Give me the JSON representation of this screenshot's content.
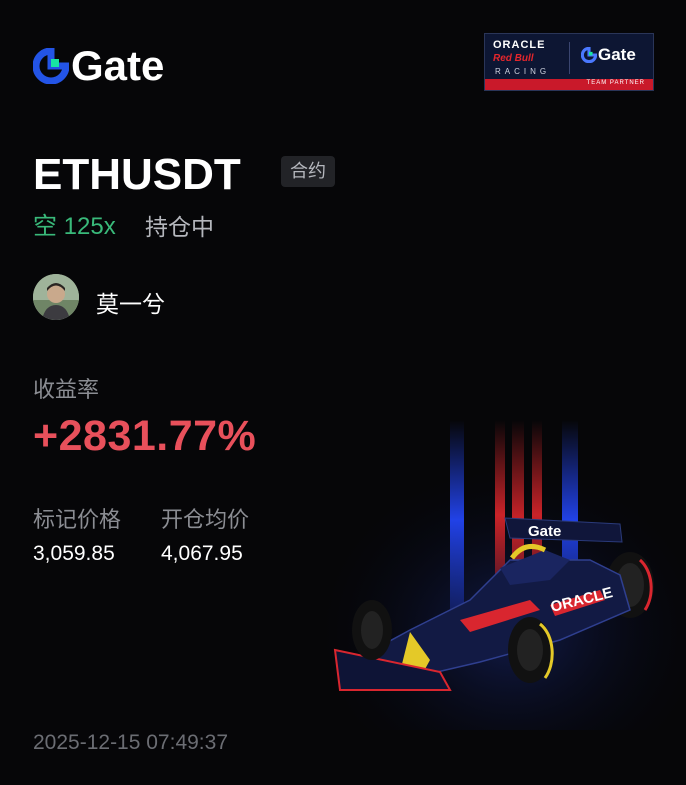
{
  "brand": {
    "name": "Gate",
    "icon": "gate-logo-icon"
  },
  "partner": {
    "line1": "ORACLE",
    "line2": "Red Bull",
    "line3": "RACING",
    "brand": "Gate",
    "caption": "TEAM PARTNER"
  },
  "position": {
    "symbol": "ETHUSDT",
    "type_tag": "合约",
    "direction": "空 125x",
    "status": "持仓中"
  },
  "user": {
    "name": "莫一兮"
  },
  "stats": {
    "roi_label": "收益率",
    "roi_value": "+2831.77%",
    "mark_price_label": "标记价格",
    "mark_price_value": "3,059.85",
    "open_price_label": "开仓均价",
    "open_price_value": "4,067.95"
  },
  "timestamp": "2025-12-15 07:49:37",
  "colors": {
    "accent_green": "#39b97a",
    "profit_red": "#e8505b",
    "brand_blue": "#2354e6",
    "brand_green": "#17e6a1"
  }
}
